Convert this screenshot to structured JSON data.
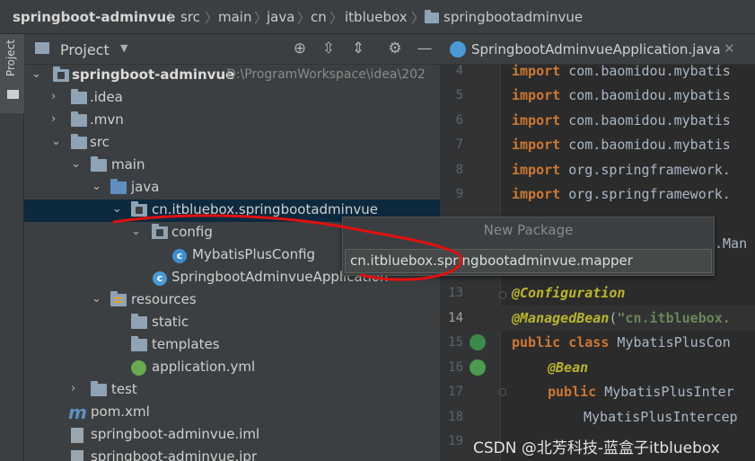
{
  "breadcrumb": {
    "project": "springboot-adminvue",
    "parts": [
      "src",
      "main",
      "java",
      "cn",
      "itbluebox",
      "springbootadminvue"
    ]
  },
  "sidebar": {
    "tab_label": "Project"
  },
  "panel": {
    "title": "Project",
    "tools": [
      "locate-icon",
      "expand-all-icon",
      "collapse-all-icon",
      "gear-icon",
      "minimize-icon"
    ]
  },
  "tree": [
    {
      "label": "springboot-adminvue",
      "hint": "D:\\ProgramWorkspace\\idea\\202"
    },
    {
      "label": ".idea"
    },
    {
      "label": ".mvn"
    },
    {
      "label": "src"
    },
    {
      "label": "main"
    },
    {
      "label": "java"
    },
    {
      "label": "cn.itbluebox.springbootadminvue"
    },
    {
      "label": "config"
    },
    {
      "label": "MybatisPlusConfig"
    },
    {
      "label": "SpringbootAdminvueApplication"
    },
    {
      "label": "resources"
    },
    {
      "label": "static"
    },
    {
      "label": "templates"
    },
    {
      "label": "application.yml"
    },
    {
      "label": "test"
    },
    {
      "label": "pom.xml"
    },
    {
      "label": "springboot-adminvue.iml"
    },
    {
      "label": "springboot-adminvue.ipr"
    }
  ],
  "editor": {
    "tab_title": "SpringbootAdminvueApplication.java",
    "lines": [
      {
        "no": "4",
        "kw": "import",
        "text": " com.baomidou.mybatis"
      },
      {
        "no": "5",
        "kw": "import",
        "text": " com.baomidou.mybatis"
      },
      {
        "no": "6",
        "kw": "import",
        "text": " com.baomidou.mybatis"
      },
      {
        "no": "7",
        "kw": "import",
        "text": " com.baomidou.mybatis"
      },
      {
        "no": "8",
        "kw": "import",
        "text": " org.springframework."
      },
      {
        "no": "9",
        "kw": "import",
        "text": " org.springframework."
      },
      {
        "no": "13",
        "ann": "@Configuration"
      },
      {
        "no": "14",
        "ann": "@ManagedBean",
        "rest1": "(",
        "str": "\"cn.itbluebox."
      },
      {
        "no": "15",
        "kw": "public class",
        "text": " MybatisPlusCon"
      },
      {
        "no": "16",
        "ann": "@Bean"
      },
      {
        "no": "17",
        "kw": "public",
        "text": " MybatisPlusInter"
      },
      {
        "no": "18",
        "text": "MybatisPlusIntercep"
      },
      {
        "no": "19",
        "text": ""
      }
    ],
    "partial_line": ".Man"
  },
  "popup": {
    "title": "New Package",
    "value": "cn.itbluebox.springbootadminvue.mapper"
  },
  "watermark": "CSDN @北芳科技-蓝盒子itbluebox",
  "colors": {
    "annotation_red": "#e01010",
    "selection": "#0d293e"
  }
}
